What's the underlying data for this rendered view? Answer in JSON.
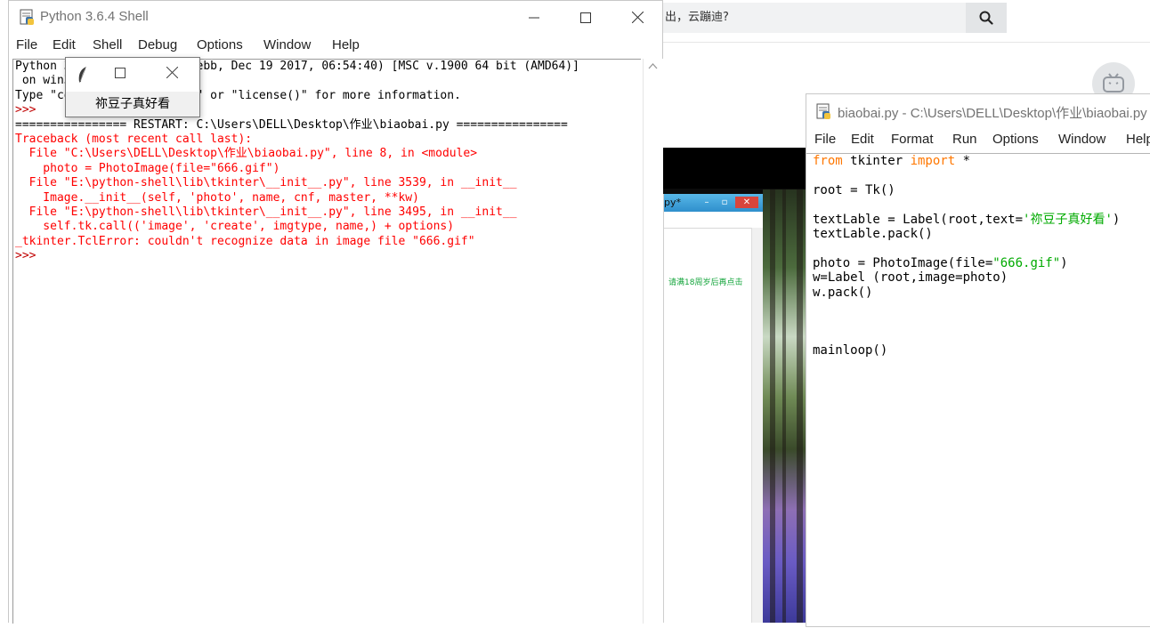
{
  "browser": {
    "search_text": "出，云蹦迪?",
    "search_icon": "search-icon",
    "avatar_icon": "tv-mascot-icon"
  },
  "background_popup": {
    "title": "py*",
    "note": "请满18周岁后再点击"
  },
  "shell": {
    "title": "Python 3.6.4 Shell",
    "menu": [
      "File",
      "Edit",
      "Shell",
      "Debug",
      "Options",
      "Window",
      "Help"
    ],
    "lines": [
      {
        "text": "Python 3.6.4 (v3.6.4:d48ecebb, Dec 19 2017, 06:54:40) [MSC v.1900 64 bit (AMD64)]",
        "style": "black"
      },
      {
        "text": " on win32",
        "style": "black"
      },
      {
        "text": "Type \"copyright\", \"credits\" or \"license()\" for more information.",
        "style": "black"
      },
      {
        "text": ">>> ",
        "style": "prompt"
      },
      {
        "text": "================ RESTART: C:\\Users\\DELL\\Desktop\\作业\\biaobai.py ================",
        "style": "black"
      },
      {
        "text": "Traceback (most recent call last):",
        "style": "red"
      },
      {
        "text": "  File \"C:\\Users\\DELL\\Desktop\\作业\\biaobai.py\", line 8, in <module>",
        "style": "red"
      },
      {
        "text": "    photo = PhotoImage(file=\"666.gif\")",
        "style": "red"
      },
      {
        "text": "  File \"E:\\python-shell\\lib\\tkinter\\__init__.py\", line 3539, in __init__",
        "style": "red"
      },
      {
        "text": "    Image.__init__(self, 'photo', name, cnf, master, **kw)",
        "style": "red"
      },
      {
        "text": "  File \"E:\\python-shell\\lib\\tkinter\\__init__.py\", line 3495, in __init__",
        "style": "red"
      },
      {
        "text": "    self.tk.call(('image', 'create', imgtype, name,) + options)",
        "style": "red"
      },
      {
        "text": "_tkinter.TclError: couldn't recognize data in image file \"666.gif\"",
        "style": "red"
      },
      {
        "text": ">>> ",
        "style": "prompt"
      }
    ]
  },
  "tk_window": {
    "label": "祢豆子真好看"
  },
  "editor": {
    "title": "biaobai.py - C:\\Users\\DELL\\Desktop\\作业\\biaobai.py",
    "menu": [
      "File",
      "Edit",
      "Format",
      "Run",
      "Options",
      "Window",
      "Help"
    ],
    "lines": [
      [
        {
          "t": "from",
          "c": "kw"
        },
        {
          "t": " tkinter ",
          "c": ""
        },
        {
          "t": "import",
          "c": "kw"
        },
        {
          "t": " *",
          "c": ""
        }
      ],
      [],
      [
        {
          "t": "root = Tk()",
          "c": ""
        }
      ],
      [],
      [
        {
          "t": "textLable = Label(root,text=",
          "c": ""
        },
        {
          "t": "'祢豆子真好看'",
          "c": "str"
        },
        {
          "t": ")",
          "c": ""
        }
      ],
      [
        {
          "t": "textLable.pack()",
          "c": ""
        }
      ],
      [],
      [
        {
          "t": "photo = PhotoImage(file=",
          "c": ""
        },
        {
          "t": "\"666.gif\"",
          "c": "str"
        },
        {
          "t": ")",
          "c": ""
        }
      ],
      [
        {
          "t": "w=Label (root,image=photo)",
          "c": ""
        }
      ],
      [
        {
          "t": "w.pack()",
          "c": ""
        }
      ],
      [],
      [],
      [],
      [
        {
          "t": "mainloop()",
          "c": ""
        }
      ]
    ]
  },
  "colors": {
    "error": "#ff0000",
    "keyword": "#ff7700",
    "string": "#00aa00"
  }
}
